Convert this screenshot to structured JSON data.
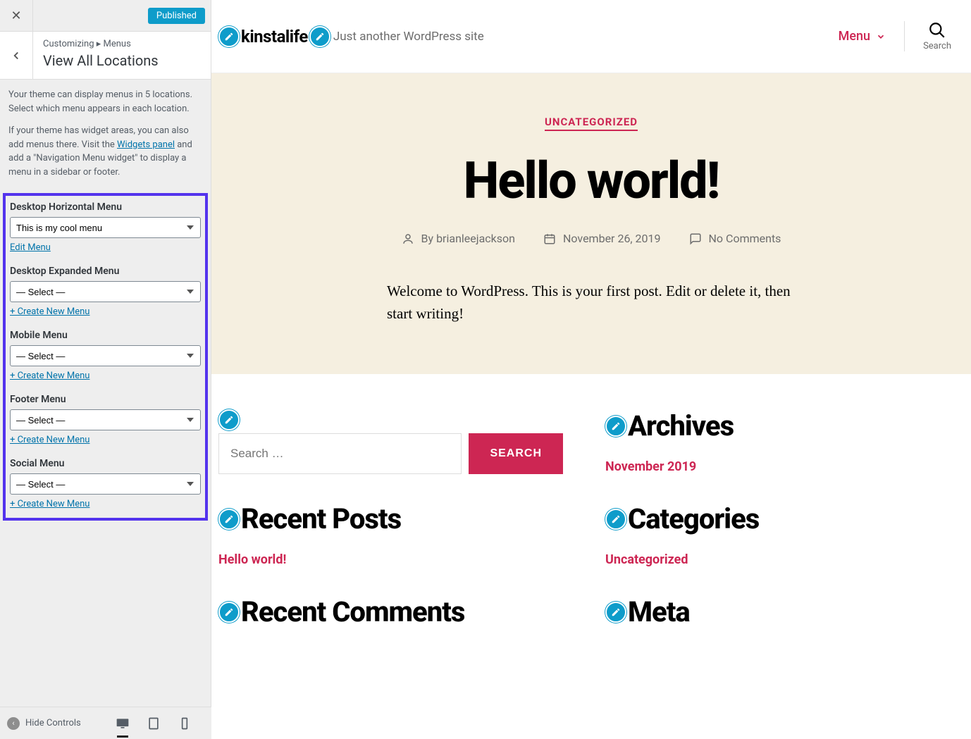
{
  "sidebar": {
    "publish_label": "Published",
    "breadcrumb": "Customizing ▸ Menus",
    "title": "View All Locations",
    "desc1": "Your theme can display menus in 5 locations. Select which menu appears in each location.",
    "desc2a": "If your theme has widget areas, you can also add menus there. Visit the ",
    "widgets_link": "Widgets panel",
    "desc2b": " and add a \"Navigation Menu widget\" to display a menu in a sidebar or footer.",
    "locations": [
      {
        "label": "Desktop Horizontal Menu",
        "value": "This is my cool menu",
        "action": "Edit Menu"
      },
      {
        "label": "Desktop Expanded Menu",
        "value": "— Select —",
        "action": "+ Create New Menu"
      },
      {
        "label": "Mobile Menu",
        "value": "— Select —",
        "action": "+ Create New Menu"
      },
      {
        "label": "Footer Menu",
        "value": "— Select —",
        "action": "+ Create New Menu"
      },
      {
        "label": "Social Menu",
        "value": "— Select —",
        "action": "+ Create New Menu"
      }
    ],
    "hide_controls": "Hide Controls"
  },
  "preview": {
    "site_title": "kinstalife",
    "tagline": "Just another WordPress site",
    "menu_label": "Menu",
    "search_label": "Search",
    "category": "UNCATEGORIZED",
    "post_title": "Hello world!",
    "by_label": "By",
    "author": "brianleejackson",
    "date": "November 26, 2019",
    "comments": "No Comments",
    "excerpt": "Welcome to WordPress. This is your first post. Edit or delete it, then start writing!",
    "search_placeholder": "Search …",
    "search_button": "SEARCH",
    "widgets": {
      "archives_title": "Archives",
      "archives_link": "November 2019",
      "recent_posts_title": "Recent Posts",
      "recent_posts_link": "Hello world!",
      "categories_title": "Categories",
      "categories_link": "Uncategorized",
      "recent_comments_title": "Recent Comments",
      "meta_title": "Meta"
    }
  }
}
